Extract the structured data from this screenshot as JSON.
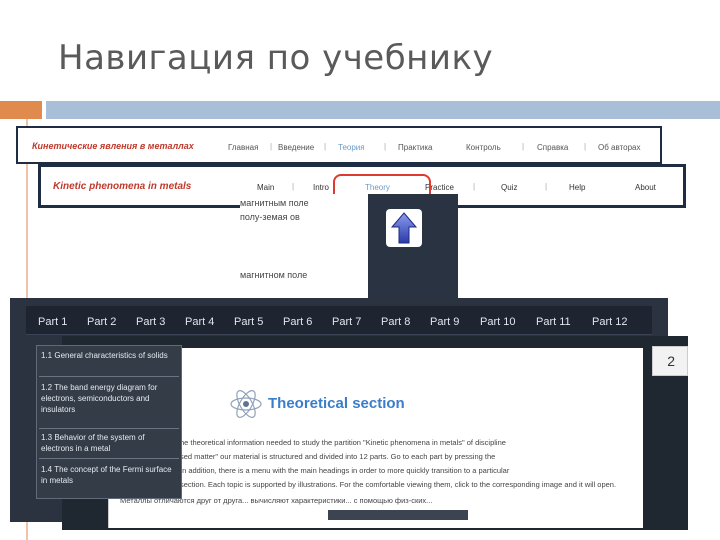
{
  "slide": {
    "title": "Навигация по учебнику"
  },
  "ru_nav": {
    "brand": "Кинетические явления в металлах",
    "items": [
      "Главная",
      "Введение",
      "Теория",
      "Практика",
      "Контроль",
      "Справка",
      "Об авторах"
    ],
    "active": "Теория"
  },
  "en_nav": {
    "brand": "Kinetic phenomena in metals",
    "items": [
      "Main",
      "Intro",
      "Theory",
      "Practice",
      "Quiz",
      "Help",
      "About"
    ],
    "active": "Theory"
  },
  "fragment": {
    "line1": "магнитным поле",
    "line2": "полу-земая ов",
    "line3": "магнитном поле"
  },
  "parts": [
    "Part 1",
    "Part 2",
    "Part 3",
    "Part 4",
    "Part 5",
    "Part 6",
    "Part 7",
    "Part 8",
    "Part 9",
    "Part 10",
    "Part 11",
    "Part 12"
  ],
  "theory": {
    "edge_number": "2",
    "title": "Theoretical section",
    "lines": [
      "he theoretical information needed to study the partition \"Kinetic phenomena in metals\" of discipline",
      "sed matter\" our material is structured and divided into 12 parts. Go to each part by pressing the",
      "In addition, there is a menu with the main headings in order to more quickly transition to a particular",
      "section. Each topic is supported by illustrations. For the comfortable viewing them, click to the corresponding image and it will open.",
      "Металлы отличаются друг от друга... вычисляют характеристики... с помощью физ-ских..."
    ]
  },
  "dropdown": {
    "items": [
      "1.1 General characteristics of solids",
      "1.2 The band energy diagram for electrons, semiconductors and insulators",
      "1.3 Behavior of the system of electrons in a metal",
      "1.4 The concept of the Fermi surface in metals"
    ]
  },
  "colors": {
    "accent_orange": "#e08a4e",
    "accent_blue": "#a9bfd8",
    "highlight_red": "#e03a2f",
    "brand_red": "#c0392b",
    "link_blue": "#3b7dc8"
  }
}
